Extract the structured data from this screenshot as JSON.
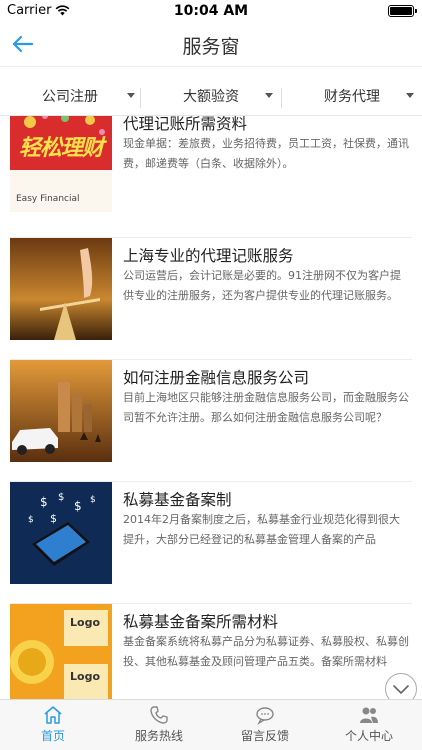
{
  "status_bar": {
    "carrier": "Carrier",
    "time": "10:04 AM"
  },
  "nav": {
    "title": "服务窗",
    "back_icon": "back-arrow-icon"
  },
  "filters": [
    {
      "label": "公司注册"
    },
    {
      "label": "大额验资"
    },
    {
      "label": "财务代理"
    }
  ],
  "articles": [
    {
      "title": "代理记账所需资料",
      "summary": "现金单据：差旅费，业务招待费，员工工资，社保费，通讯费，邮递费等（白条、收据除外）。",
      "thumb_text_big": "轻松理财",
      "thumb_text_small": "Easy Financial"
    },
    {
      "title": "上海专业的代理记账服务",
      "summary": "公司运营后，会计记账是必要的。91注册网不仅为客户提供专业的注册服务，还为客户提供专业的代理记账服务。"
    },
    {
      "title": "如何注册金融信息服务公司",
      "summary": "目前上海地区只能够注册金融信息服务公司，而金融服务公司暂不允许注册。那么如何注册金融信息服务公司呢？"
    },
    {
      "title": "私募基金备案制",
      "summary": "2014年2月备案制度之后，私募基金行业规范化得到很大提升，大部分已经登记的私募基金管理人备案的产品"
    },
    {
      "title": "私募基金备案所需材料",
      "summary": "基金备案系统将私募产品分为私募证券、私募股权、私募创投、其他私募基金及顾问管理产品五类。备案所需材料",
      "thumb_text_a": "Logo",
      "thumb_text_b": "Logo"
    }
  ],
  "tabs": [
    {
      "label": "首页",
      "icon": "home-icon",
      "active": true
    },
    {
      "label": "服务热线",
      "icon": "phone-icon",
      "active": false
    },
    {
      "label": "留言反馈",
      "icon": "chat-bubble-icon",
      "active": false
    },
    {
      "label": "个人中心",
      "icon": "user-group-icon",
      "active": false
    }
  ],
  "colors": {
    "accent": "#2a9be0",
    "text": "#222222",
    "muted": "#666666"
  }
}
